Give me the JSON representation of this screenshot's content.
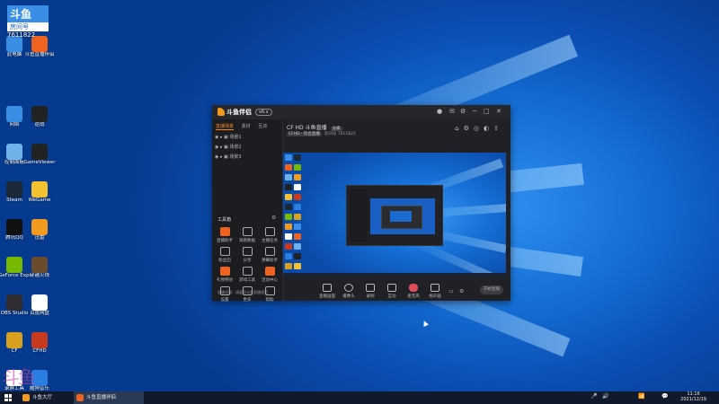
{
  "overlay_logo": {
    "line1": "斗鱼",
    "line2": "房间号",
    "room_number": "7611822"
  },
  "watermark": "斗鱼",
  "desktop_icons": [
    {
      "label": "此电脑",
      "color": "#3a8ee6",
      "icon": "computer-icon"
    },
    {
      "label": "斗鱼直播伴侣",
      "color": "#f0631e",
      "icon": "douyu-icon"
    },
    {
      "label": "网络",
      "color": "#3a8ee6",
      "icon": "network-icon"
    },
    {
      "label": "逆战",
      "color": "#222222",
      "icon": "game-icon"
    },
    {
      "label": "控制面板",
      "color": "#6fb2ea",
      "icon": "control-panel-icon"
    },
    {
      "label": "GameViewer",
      "color": "#222222",
      "icon": "gameviewer-icon"
    },
    {
      "label": "Steam",
      "color": "#1b2838",
      "icon": "steam-icon"
    },
    {
      "label": "WeGame",
      "color": "#f2c230",
      "icon": "wegame-icon"
    },
    {
      "label": "腾讯QQ",
      "color": "#111111",
      "icon": "qq-icon"
    },
    {
      "label": "迅雷",
      "color": "#f29a1e",
      "icon": "thunder-icon"
    },
    {
      "label": "GeForce Experience",
      "color": "#76b900",
      "icon": "geforce-icon"
    },
    {
      "label": "穿越火线",
      "color": "#6b4b2a",
      "icon": "crossfire-icon"
    },
    {
      "label": "OBS Studio",
      "color": "#302e31",
      "icon": "obs-icon"
    },
    {
      "label": "百度网盘",
      "color": "#ffffff",
      "icon": "baidu-netdisk-icon"
    },
    {
      "label": "CF",
      "color": "#d9a020",
      "icon": "cf-icon"
    },
    {
      "label": "CFHD",
      "color": "#c83a1e",
      "icon": "cfhd-icon"
    },
    {
      "label": "录屏工具",
      "color": "#ffffff",
      "icon": "recorder-icon"
    },
    {
      "label": "酷狗音乐",
      "color": "#2a7de1",
      "icon": "kugou-icon"
    }
  ],
  "app": {
    "brand": "斗鱼伴侣",
    "version_badge": "v6.x",
    "window_controls": [
      "─",
      "□",
      "✕"
    ],
    "left_tabs": [
      "直播场景",
      "素材",
      "互动"
    ],
    "scenes": [
      "场景1",
      "场景2",
      "场景3"
    ],
    "tools_title": "工具箱",
    "tools": [
      {
        "label": "直播助手",
        "orange": true
      },
      {
        "label": "观看数据",
        "orange": false
      },
      {
        "label": "主播任务",
        "orange": false
      },
      {
        "label": "粉丝团",
        "orange": false
      },
      {
        "label": "分享",
        "orange": false
      },
      {
        "label": "弹幕助手",
        "orange": false
      },
      {
        "label": "礼物特效",
        "orange": true
      },
      {
        "label": "游戏工具",
        "orange": false
      },
      {
        "label": "活动中心",
        "orange": true
      },
      {
        "label": "设置",
        "orange": false
      },
      {
        "label": "更多",
        "orange": false
      },
      {
        "label": "帮助",
        "orange": false
      }
    ],
    "notice": "直播须知：请遵守斗鱼直播规范",
    "room_title": "CF HD 斗鱼直播",
    "room_tag": "分类",
    "room_sub_chip": "CFHD · 综合直播",
    "room_sub_text": "房间号 7611822",
    "top_icons": [
      "⌂",
      "⚙",
      "◎",
      "◐",
      "⇧"
    ],
    "bottom_buttons": [
      "直播画面",
      "摄像头",
      "录制",
      "互动",
      "麦克风",
      "扬声器"
    ],
    "start_label": "开始直播"
  },
  "taskbar": {
    "items": [
      {
        "label": "斗鱼大厅",
        "color": "#f29a1e"
      },
      {
        "label": "斗鱼直播伴侣",
        "color": "#f0631e"
      }
    ],
    "tray_icons": [
      "🎤",
      "🔊",
      "📶",
      "💬"
    ],
    "time": "11:16",
    "date": "2021/12/19"
  }
}
